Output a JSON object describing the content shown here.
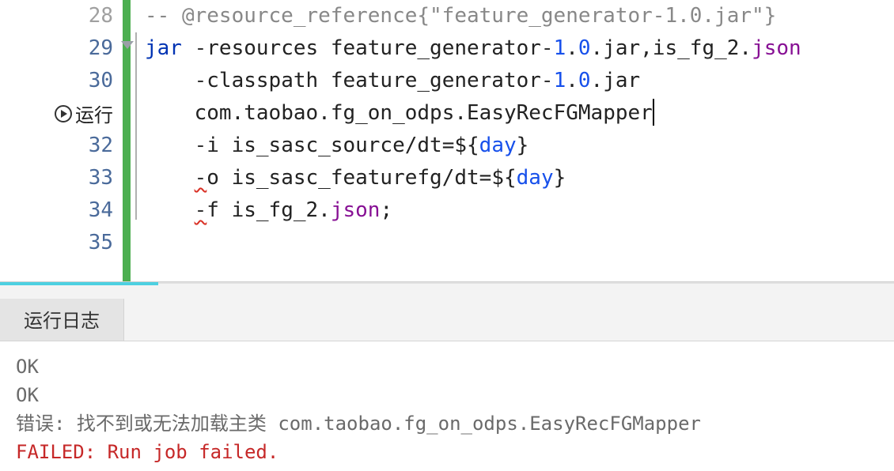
{
  "editor": {
    "lines": [
      {
        "num": "28",
        "highlighted": false,
        "segments": [
          {
            "cls": "c-comment",
            "t": "-- @resource_reference{\"feature_generator-1.0.jar\"}"
          }
        ]
      },
      {
        "num": "29",
        "highlighted": true,
        "fold": true,
        "segments": [
          {
            "cls": "c-keyword",
            "t": "jar"
          },
          {
            "cls": "c-text",
            "t": " "
          },
          {
            "cls": "c-dash",
            "t": "-"
          },
          {
            "cls": "c-text",
            "t": "resources feature_generator"
          },
          {
            "cls": "c-dash",
            "t": "-"
          },
          {
            "cls": "c-num",
            "t": "1"
          },
          {
            "cls": "c-dot",
            "t": "."
          },
          {
            "cls": "c-num",
            "t": "0"
          },
          {
            "cls": "c-dot",
            "t": "."
          },
          {
            "cls": "c-text",
            "t": "jar"
          },
          {
            "cls": "c-text",
            "t": ","
          },
          {
            "cls": "c-text",
            "t": "is_fg_2"
          },
          {
            "cls": "c-dot",
            "t": "."
          },
          {
            "cls": "c-json",
            "t": "json"
          }
        ]
      },
      {
        "num": "30",
        "highlighted": true,
        "segments": [
          {
            "cls": "c-text",
            "t": "    "
          },
          {
            "cls": "c-dash",
            "t": "-"
          },
          {
            "cls": "c-text",
            "t": "classpath feature_generator"
          },
          {
            "cls": "c-dash",
            "t": "-"
          },
          {
            "cls": "c-num",
            "t": "1"
          },
          {
            "cls": "c-dot",
            "t": "."
          },
          {
            "cls": "c-num",
            "t": "0"
          },
          {
            "cls": "c-dot",
            "t": "."
          },
          {
            "cls": "c-text",
            "t": "jar"
          }
        ]
      },
      {
        "num": "run",
        "label": "运行",
        "highlighted": false,
        "segments": [
          {
            "cls": "c-text",
            "t": "    com"
          },
          {
            "cls": "c-dot",
            "t": "."
          },
          {
            "cls": "c-text",
            "t": "taobao"
          },
          {
            "cls": "c-dot",
            "t": "."
          },
          {
            "cls": "c-text",
            "t": "fg_on_odps"
          },
          {
            "cls": "c-dot",
            "t": "."
          },
          {
            "cls": "c-text",
            "t": "EasyRecFGMapper",
            "cursor": true
          }
        ]
      },
      {
        "num": "32",
        "highlighted": true,
        "segments": [
          {
            "cls": "c-text",
            "t": "    "
          },
          {
            "cls": "c-dash",
            "t": "-"
          },
          {
            "cls": "c-text",
            "t": "i is_sasc_source"
          },
          {
            "cls": "c-slash",
            "t": "/"
          },
          {
            "cls": "c-text",
            "t": "dt"
          },
          {
            "cls": "c-eq",
            "t": "="
          },
          {
            "cls": "c-dollar",
            "t": "$"
          },
          {
            "cls": "c-brace",
            "t": "{"
          },
          {
            "cls": "c-var",
            "t": "day"
          },
          {
            "cls": "c-brace",
            "t": "}"
          }
        ]
      },
      {
        "num": "33",
        "highlighted": true,
        "segments": [
          {
            "cls": "c-text",
            "t": "    "
          },
          {
            "cls": "c-dash squiggle",
            "t": "-"
          },
          {
            "cls": "c-text",
            "t": "o is_sasc_featurefg"
          },
          {
            "cls": "c-slash",
            "t": "/"
          },
          {
            "cls": "c-text",
            "t": "dt"
          },
          {
            "cls": "c-eq",
            "t": "="
          },
          {
            "cls": "c-dollar",
            "t": "$"
          },
          {
            "cls": "c-brace",
            "t": "{"
          },
          {
            "cls": "c-var",
            "t": "day"
          },
          {
            "cls": "c-brace",
            "t": "}"
          }
        ]
      },
      {
        "num": "34",
        "highlighted": true,
        "segments": [
          {
            "cls": "c-text",
            "t": "    "
          },
          {
            "cls": "c-dash squiggle",
            "t": "-"
          },
          {
            "cls": "c-text",
            "t": "f is_fg_2"
          },
          {
            "cls": "c-dot",
            "t": "."
          },
          {
            "cls": "c-json",
            "t": "json"
          },
          {
            "cls": "c-semi",
            "t": ";"
          }
        ]
      },
      {
        "num": "35",
        "highlighted": true,
        "segments": []
      }
    ]
  },
  "tabs": {
    "log_label": "运行日志"
  },
  "log": {
    "lines": [
      {
        "t": "OK",
        "error": false,
        "cn": false
      },
      {
        "t": "OK",
        "error": false,
        "cn": false
      },
      {
        "t": "错误: 找不到或无法加载主类 com.taobao.fg_on_odps.EasyRecFGMapper",
        "error": false,
        "cn": true
      },
      {
        "t": "FAILED: Run job failed.",
        "error": true,
        "cn": false
      }
    ]
  }
}
